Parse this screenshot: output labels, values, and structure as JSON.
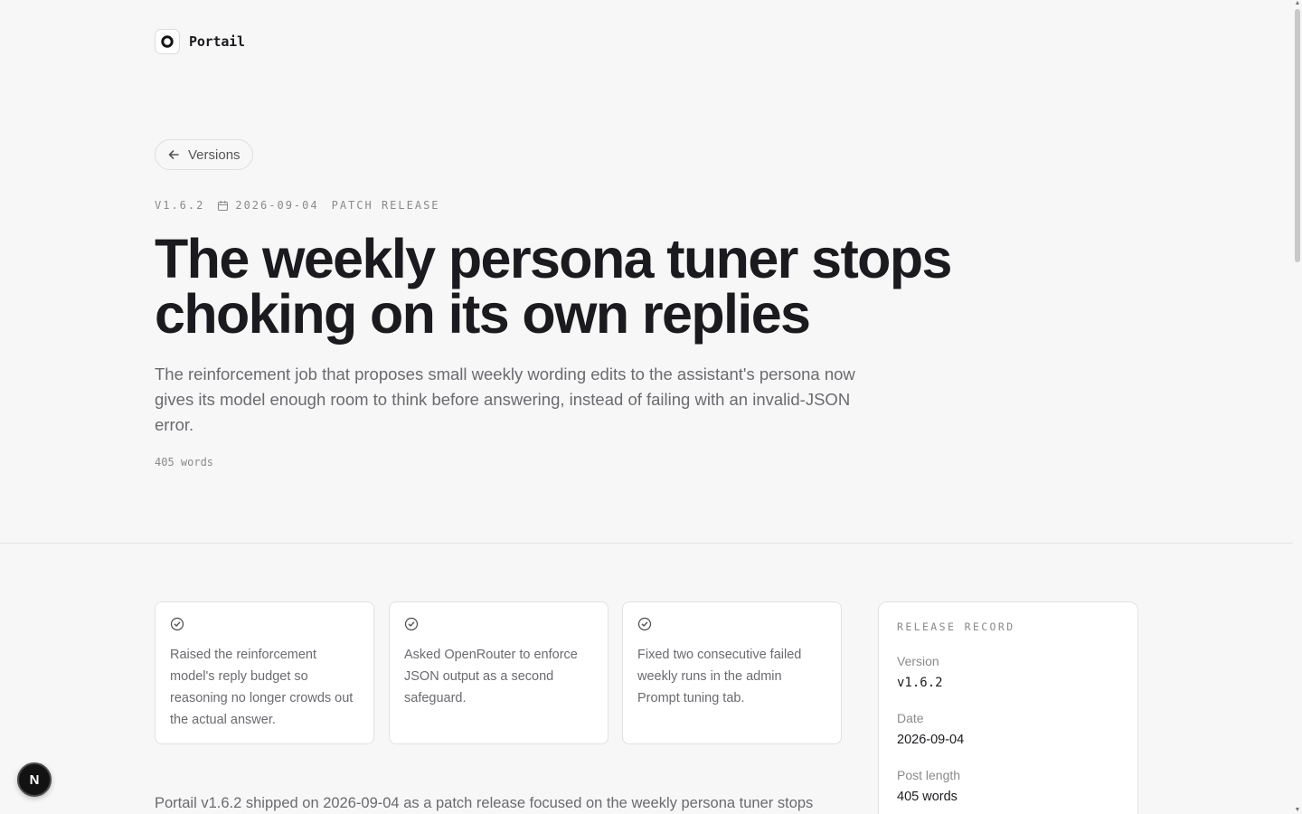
{
  "brand": {
    "name": "Portail",
    "logo_icon": "ring-logo-icon"
  },
  "nav": {
    "back_label": "Versions",
    "back_icon": "arrow-left-icon"
  },
  "meta": {
    "version": "V1.6.2",
    "date": "2026-09-04",
    "release_type": "PATCH RELEASE",
    "date_icon": "calendar-icon"
  },
  "headline": {
    "title": "The weekly persona tuner stops choking on its own replies",
    "lede": "The reinforcement job that proposes small weekly wording edits to the assistant's persona now gives its model enough room to think before answering, instead of failing with an invalid-JSON error.",
    "word_count": "405 words"
  },
  "highlights": [
    {
      "icon": "check-circle-icon",
      "text": "Raised the reinforcement model's reply budget so reasoning no longer crowds out the actual answer."
    },
    {
      "icon": "check-circle-icon",
      "text": "Asked OpenRouter to enforce JSON output as a second safeguard."
    },
    {
      "icon": "check-circle-icon",
      "text": "Fixed two consecutive failed weekly runs in the admin Prompt tuning tab."
    }
  ],
  "body": {
    "intro": "Portail v1.6.2 shipped on 2026-09-04 as a patch release focused on the weekly persona tuner stops"
  },
  "record": {
    "heading": "RELEASE RECORD",
    "version_label": "Version",
    "version_value": "v1.6.2",
    "date_label": "Date",
    "date_value": "2026-09-04",
    "length_label": "Post length",
    "length_value": "405 words"
  },
  "floating_badge": {
    "label": "N"
  }
}
